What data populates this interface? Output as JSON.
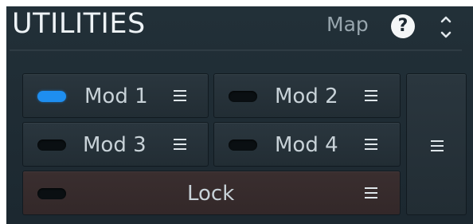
{
  "header": {
    "title": "UTILITIES",
    "map_label": "Map",
    "help_glyph": "?",
    "help_icon": "help-icon",
    "expand_icon": "expand-collapse-icon"
  },
  "buttons": [
    {
      "label": "Mod 1",
      "active": true
    },
    {
      "label": "Mod 2",
      "active": false
    },
    {
      "label": "Mod 3",
      "active": false
    },
    {
      "label": "Mod 4",
      "active": false
    }
  ],
  "lock": {
    "label": "Lock",
    "active": false
  },
  "colors": {
    "panel_bg": "#1f2b33",
    "led_on": "#1e8ef0",
    "led_off": "#0a0f12",
    "lock_bg": "#352a2b",
    "text": "#c8d2d8"
  }
}
